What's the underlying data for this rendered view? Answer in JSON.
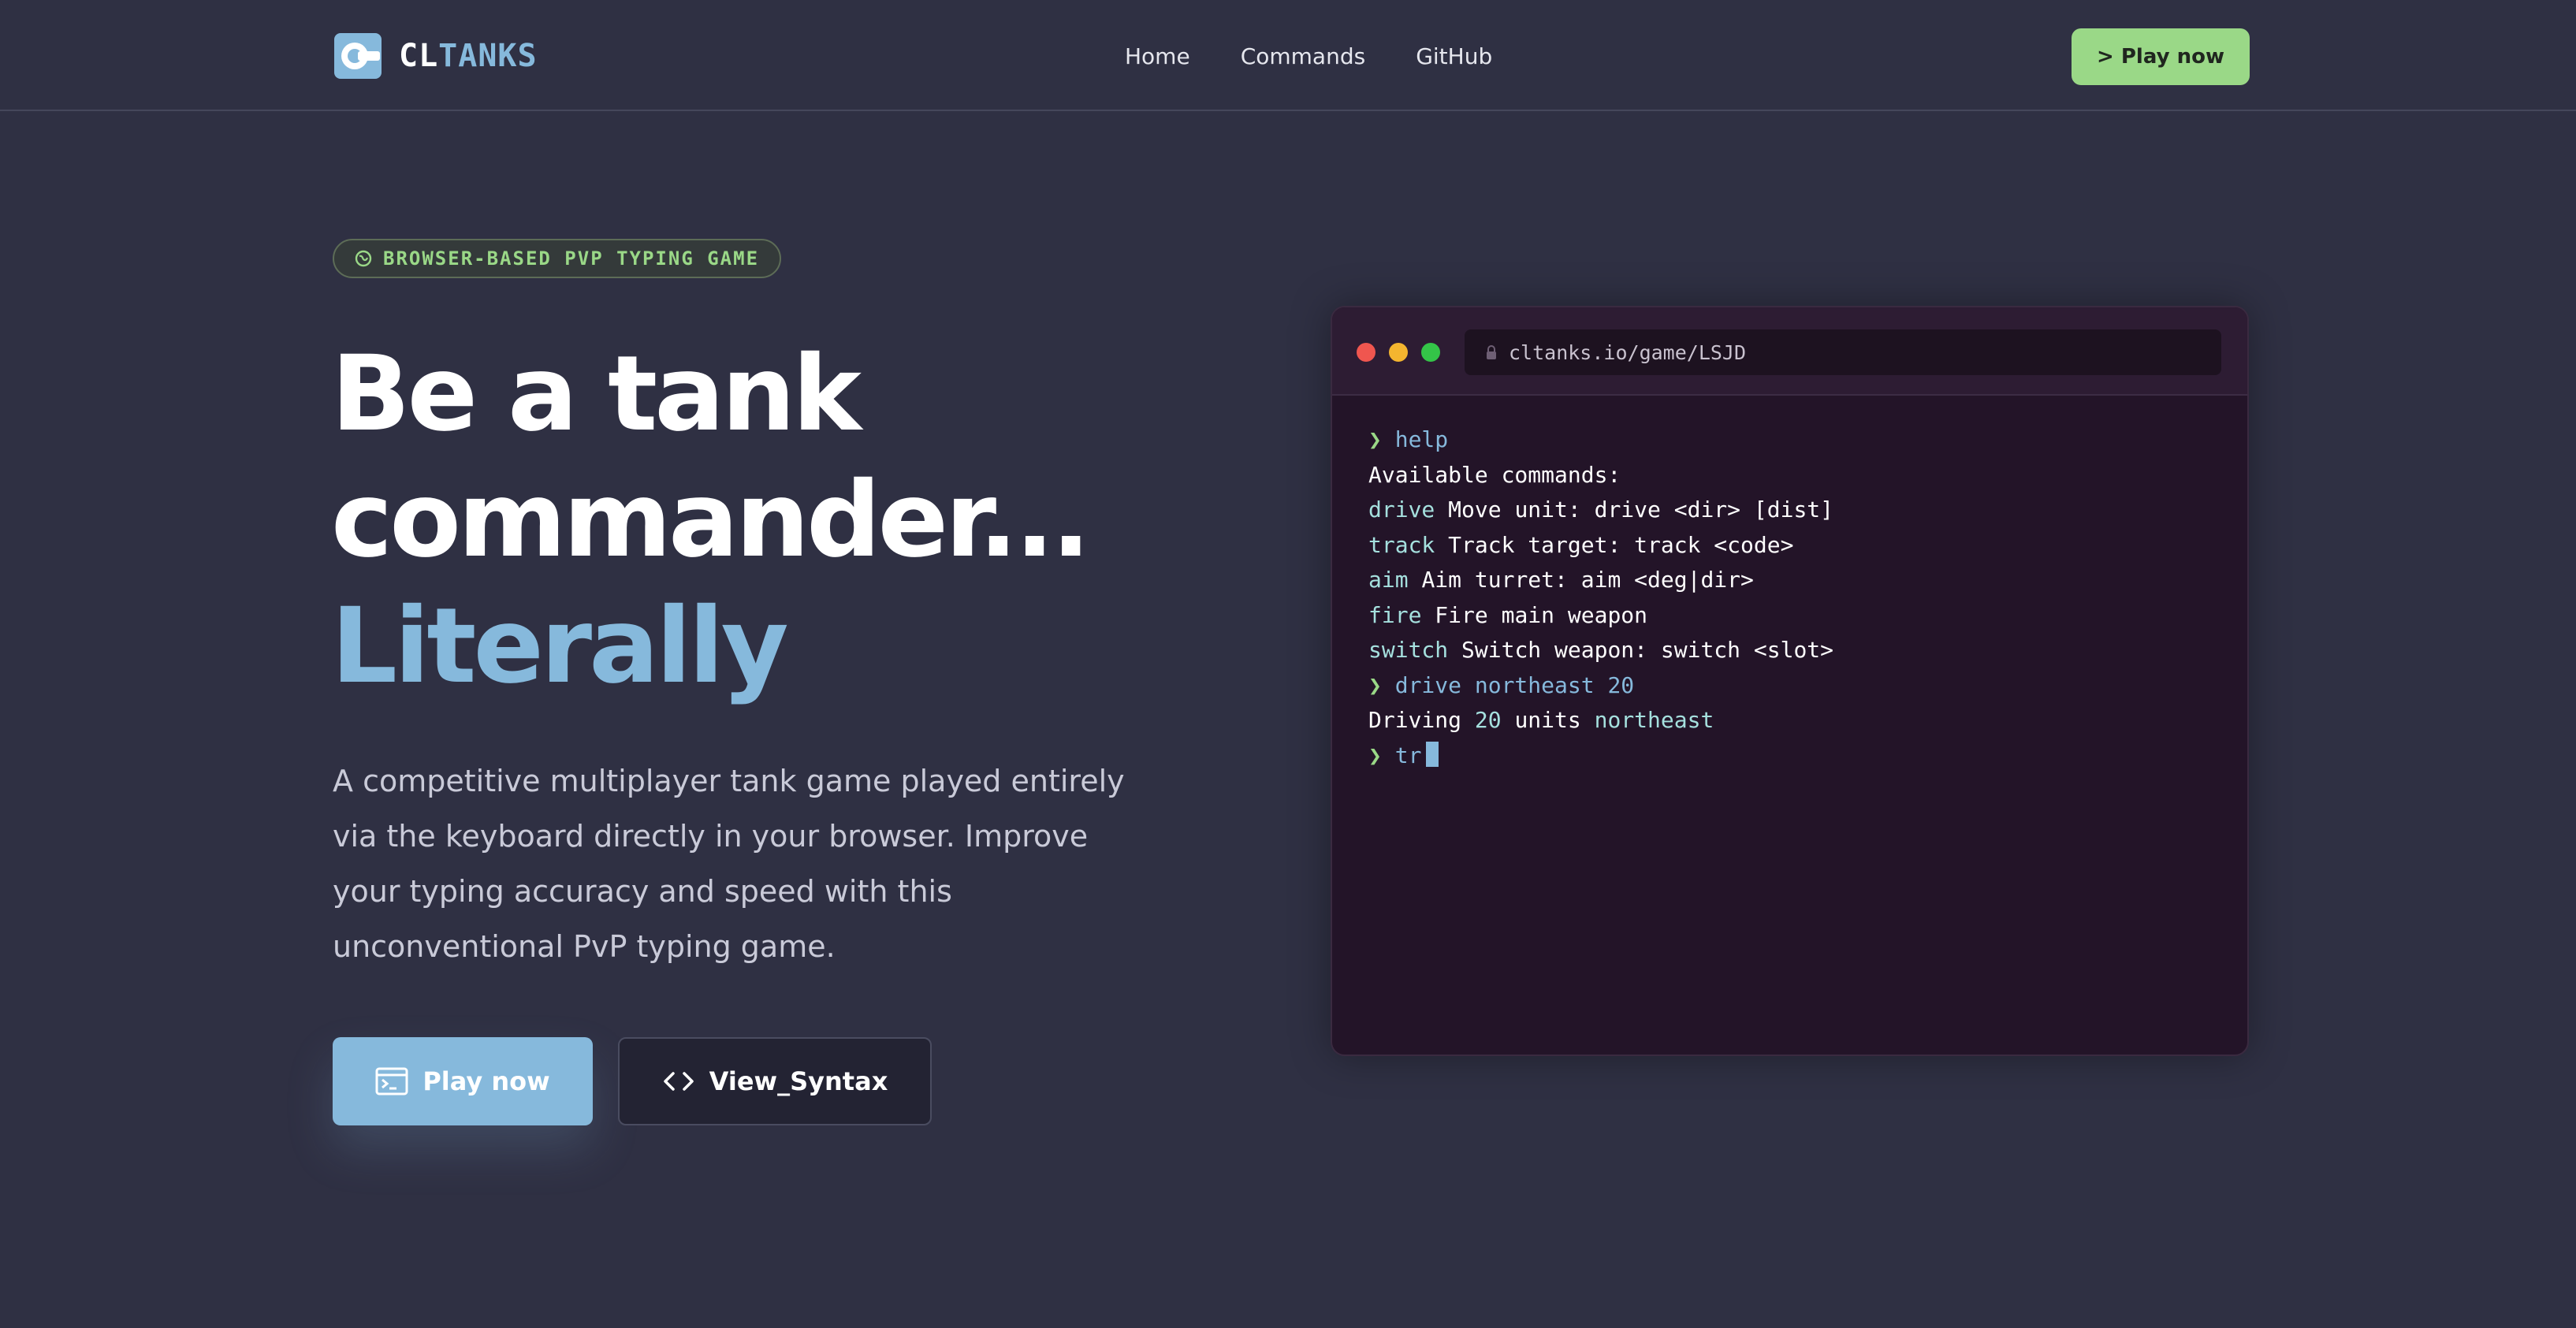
{
  "nav": {
    "brand_cl": "CL",
    "brand_tanks": "TANKS",
    "links": [
      "Home",
      "Commands",
      "GitHub"
    ],
    "cta_label": "> Play now"
  },
  "hero": {
    "badge": "BROWSER-BASED PVP TYPING GAME",
    "headline_line1": "Be a tank",
    "headline_line2": "commander...",
    "headline_accent": "Literally",
    "description": "A competitive multiplayer tank game played entirely via the keyboard directly in your browser. Improve your typing accuracy and speed with this unconventional PvP typing game.",
    "play_label": "Play now",
    "syntax_label": "View_Syntax"
  },
  "terminal": {
    "url": "cltanks.io/game/LSJD",
    "prompt_symbol": "❯",
    "help_cmd": "help",
    "available": "Available commands:",
    "commands": [
      {
        "name": "drive",
        "desc": "Move unit: drive <dir> [dist]"
      },
      {
        "name": "track",
        "desc": "Track target: track <code>"
      },
      {
        "name": "aim",
        "desc": "Aim turret: aim <deg|dir>"
      },
      {
        "name": "fire",
        "desc": "Fire main weapon"
      },
      {
        "name": "switch",
        "desc": "Switch weapon: switch <slot>"
      }
    ],
    "drive_cmd": "drive northeast 20",
    "driving_prefix": "Driving",
    "driving_value": "20",
    "driving_units": "units",
    "driving_dir": "northeast",
    "current_input": "tr"
  },
  "colors": {
    "background": "#2f3043",
    "accent_blue": "#86b9dc",
    "accent_green": "#9ad887",
    "terminal_bg": "#231428"
  }
}
